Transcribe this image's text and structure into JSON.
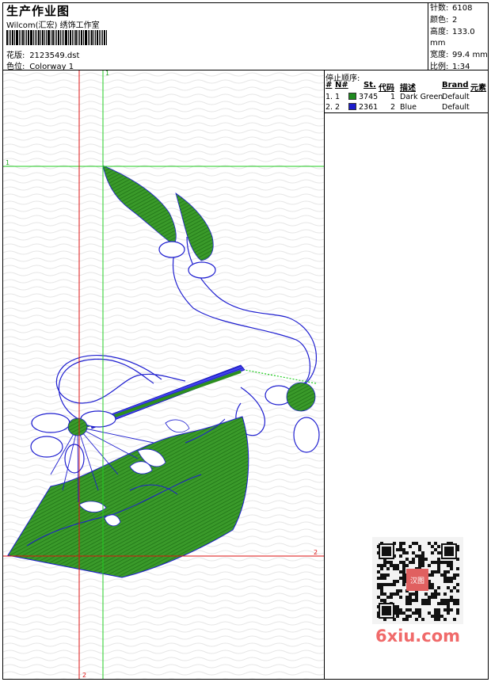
{
  "header": {
    "title": "生产作业图",
    "company": "Wilcom(汇宏) 绣饰工作室",
    "design_label": "花版:",
    "design_file": "2123549.dst",
    "color_label": "色位:",
    "colorway": "Colorway 1"
  },
  "stats": [
    {
      "label": "针数:",
      "value": "6108"
    },
    {
      "label": "颜色:",
      "value": "2"
    },
    {
      "label": "高度:",
      "value": "133.0 mm"
    },
    {
      "label": "宽度:",
      "value": "99.4 mm"
    },
    {
      "label": "比例:",
      "value": "1:34"
    }
  ],
  "stop_sequence": {
    "title": "停止顺序:",
    "columns": [
      "#",
      "N#",
      "St.",
      "代码",
      "描述",
      "Brand",
      "元素"
    ],
    "rows": [
      {
        "num": "1.",
        "needle": "1",
        "color": "#1e8a1e",
        "stitches": "3745",
        "code": "1",
        "description": "Dark Green",
        "brand": "Default"
      },
      {
        "num": "2.",
        "needle": "2",
        "color": "#1c1ccc",
        "stitches": "2361",
        "code": "2",
        "description": "Blue",
        "brand": "Default"
      }
    ]
  },
  "guides": {
    "green_v_label": "1",
    "green_h_label": "1",
    "red_h_label": "2",
    "red_v_label": "2"
  },
  "colors": {
    "green_thread": "#2c8f1f",
    "blue_thread": "#1f1fd0",
    "guide_green": "#22cc22",
    "guide_red": "#dd1111"
  },
  "watermark": {
    "qr_stamp": "汉图",
    "site": "6xiu.com"
  }
}
